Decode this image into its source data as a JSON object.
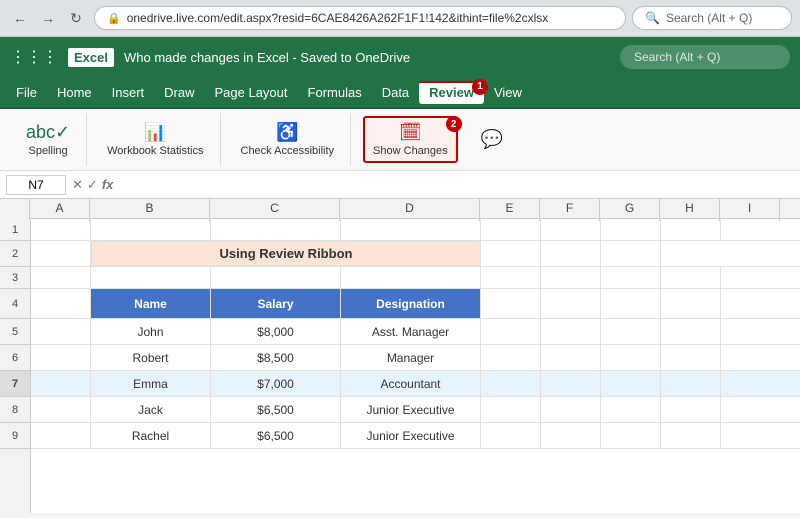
{
  "browser": {
    "url": "onedrive.live.com/edit.aspx?resid=6CAE8426A262F1F1!142&ithint=file%2cxlsx",
    "search_placeholder": "Search (Alt + Q)"
  },
  "titlebar": {
    "logo": "Excel",
    "title": "Who made changes in Excel - Saved to OneDrive",
    "save_indicator": "✓",
    "search_placeholder": "Search (Alt + Q)"
  },
  "menu": {
    "items": [
      "File",
      "Home",
      "Insert",
      "Draw",
      "Page Layout",
      "Formulas",
      "Data",
      "Review",
      "View"
    ],
    "active_index": 7
  },
  "ribbon": {
    "spelling_label": "Spelling",
    "workbook_stats_label": "Workbook Statistics",
    "accessibility_label": "Check Accessibility",
    "show_changes_label": "Show Changes",
    "comment_label": "New Comment"
  },
  "formula_bar": {
    "cell_ref": "N7",
    "formula": ""
  },
  "spreadsheet": {
    "col_headers": [
      "A",
      "B",
      "C",
      "D",
      "E",
      "F",
      "G",
      "H",
      "I"
    ],
    "rows": [
      {
        "num": 1,
        "cells": [
          "",
          "",
          "",
          "",
          "",
          "",
          "",
          "",
          ""
        ]
      },
      {
        "num": 2,
        "cells": [
          "",
          "",
          "Using Review Ribbon",
          "",
          "",
          "",
          "",
          "",
          ""
        ]
      },
      {
        "num": 3,
        "cells": [
          "",
          "",
          "",
          "",
          "",
          "",
          "",
          "",
          ""
        ]
      },
      {
        "num": 4,
        "cells": [
          "",
          "Name",
          "Salary",
          "Designation",
          "",
          "",
          "",
          "",
          ""
        ]
      },
      {
        "num": 5,
        "cells": [
          "",
          "John",
          "$8,000",
          "Asst. Manager",
          "",
          "",
          "",
          "",
          ""
        ]
      },
      {
        "num": 6,
        "cells": [
          "",
          "Robert",
          "$8,500",
          "Manager",
          "",
          "",
          "",
          "",
          ""
        ]
      },
      {
        "num": 7,
        "cells": [
          "",
          "Emma",
          "$7,000",
          "Accountant",
          "",
          "",
          "",
          "",
          ""
        ]
      },
      {
        "num": 8,
        "cells": [
          "",
          "Jack",
          "$6,500",
          "Junior Executive",
          "",
          "",
          "",
          "",
          ""
        ]
      },
      {
        "num": 9,
        "cells": [
          "",
          "Rachel",
          "$6,500",
          "Junior Executive",
          "",
          "",
          "",
          "",
          ""
        ]
      }
    ],
    "active_row": 7
  },
  "badges": {
    "menu_badge": "1",
    "ribbon_badge": "2"
  }
}
